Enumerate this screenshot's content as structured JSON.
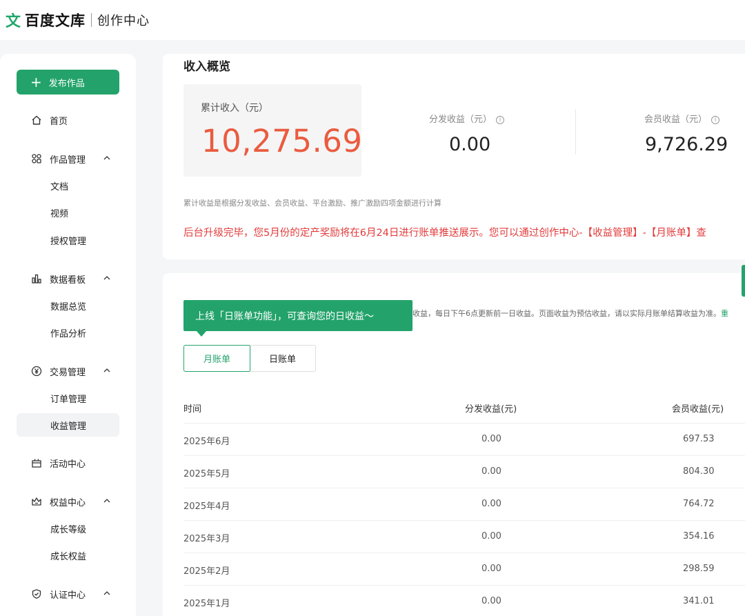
{
  "header": {
    "logo_glyph": "文",
    "logo_text": "百度文库",
    "subtitle": "创作中心"
  },
  "sidebar": {
    "publish_label": "发布作品",
    "items": [
      {
        "label": "首页",
        "icon": "home-icon"
      },
      {
        "label": "作品管理",
        "icon": "grid-icon",
        "children": [
          "文档",
          "视频",
          "授权管理"
        ]
      },
      {
        "label": "数据看板",
        "icon": "chart-icon",
        "children": [
          "数据总览",
          "作品分析"
        ]
      },
      {
        "label": "交易管理",
        "icon": "yen-icon",
        "children": [
          "订单管理",
          "收益管理"
        ]
      },
      {
        "label": "活动中心",
        "icon": "gift-icon"
      },
      {
        "label": "权益中心",
        "icon": "crown-icon",
        "children": [
          "成长等级",
          "成长权益"
        ]
      },
      {
        "label": "认证中心",
        "icon": "shield-icon"
      }
    ],
    "active": "收益管理"
  },
  "overview": {
    "title": "收入概览",
    "total_label": "累计收入（元）",
    "total_value": "10,275.69",
    "distribution_label": "分发收益（元）",
    "distribution_value": "0.00",
    "member_label": "会员收益（元）",
    "member_value": "9,726.29",
    "note": "累计收益是根据分发收益、会员收益、平台激励、推广激励四项金额进行计算",
    "notice": "后台升级完毕，您5月份的定产奖励将在6月24日进行账单推送展示。您可以通过创作中心-【收益管理】-【月账单】查"
  },
  "bills": {
    "tooltip": "上线「日账单功能」，可查询您的日收益～",
    "description": "收益，每日下午6点更新前一日收益。页面收益为预估收益，请以实际月账单结算收益为准。",
    "description_link": "重",
    "tabs": {
      "monthly": "月账单",
      "daily": "日账单"
    },
    "columns": [
      "时间",
      "分发收益(元)",
      "会员收益(元)"
    ],
    "rows": [
      [
        "2025年6月",
        "0.00",
        "697.53"
      ],
      [
        "2025年5月",
        "0.00",
        "804.30"
      ],
      [
        "2025年4月",
        "0.00",
        "764.72"
      ],
      [
        "2025年3月",
        "0.00",
        "354.16"
      ],
      [
        "2025年2月",
        "0.00",
        "298.59"
      ],
      [
        "2025年1月",
        "0.00",
        "341.01"
      ]
    ]
  }
}
